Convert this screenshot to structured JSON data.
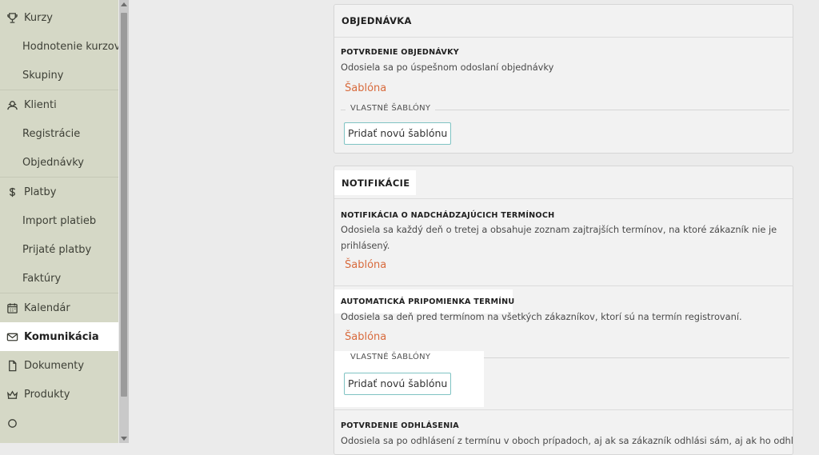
{
  "sidebar": {
    "groups": [
      {
        "items": [
          {
            "label": "Kurzy",
            "icon": "trophy-icon"
          },
          {
            "label": "Hodnotenie kurzov"
          },
          {
            "label": "Skupiny"
          }
        ]
      },
      {
        "items": [
          {
            "label": "Klienti",
            "icon": "users-icon"
          },
          {
            "label": "Registrácie"
          },
          {
            "label": "Objednávky"
          }
        ]
      },
      {
        "items": [
          {
            "label": "Platby",
            "icon": "money-icon"
          },
          {
            "label": "Import platieb"
          },
          {
            "label": "Prijaté platby"
          },
          {
            "label": "Faktúry"
          }
        ]
      },
      {
        "items": [
          {
            "label": "Kalendár",
            "icon": "calendar-icon"
          },
          {
            "label": "Komunikácia",
            "icon": "mail-icon",
            "active": true
          },
          {
            "label": "Dokumenty",
            "icon": "document-icon"
          },
          {
            "label": "Produkty",
            "icon": "products-icon"
          }
        ]
      }
    ]
  },
  "order_card": {
    "title": "OBJEDNÁVKA",
    "confirmation": {
      "title": "POTVRDENIE OBJEDNÁVKY",
      "description": "Odosiela sa po úspešnom odoslaní objednávky",
      "template_link": "Šablóna"
    },
    "custom_templates_label": "VLASTNÉ ŠABLÓNY",
    "add_template_button": "Pridať novú šablónu"
  },
  "notifications_card": {
    "title": "NOTIFIKÁCIE",
    "upcoming": {
      "title": "NOTIFIKÁCIA O NADCHÁDZAJÚCICH TERMÍNOCH",
      "description_line1": "Odosiela sa každý deň o tretej a obsahuje zoznam zajtrajších termínov, na ktoré zákazník nie je",
      "description_line2": "prihlásený.",
      "template_link": "Šablóna"
    },
    "reminder": {
      "title": "AUTOMATICKÁ PRIPOMIENKA TERMÍNU",
      "description": "Odosiela sa deň pred termínom na všetkých zákazníkov, ktorí sú na termín registrovaní.",
      "template_link": "Šablóna",
      "custom_templates_label": "VLASTNÉ ŠABLÓNY",
      "add_template_button": "Pridať novú šablónu"
    },
    "logout": {
      "title": "POTVRDENIE ODHLÁSENIA",
      "description": "Odosiela sa po odhlásení z termínu v oboch prípadoch, aj ak sa zákazník odhlási sám, aj ak ho odhlási"
    }
  }
}
